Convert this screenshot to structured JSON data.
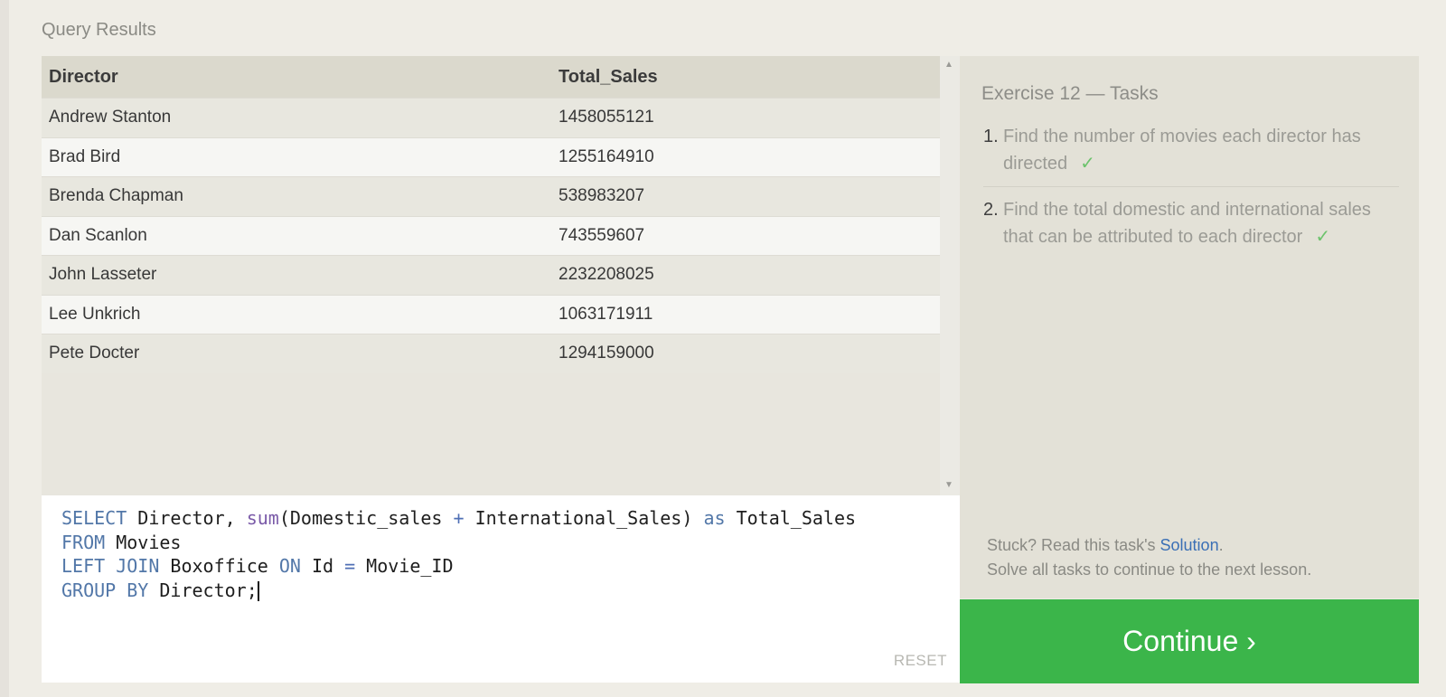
{
  "query_results": {
    "title": "Query Results",
    "columns": [
      "Director",
      "Total_Sales"
    ],
    "rows": [
      [
        "Andrew Stanton",
        "1458055121"
      ],
      [
        "Brad Bird",
        "1255164910"
      ],
      [
        "Brenda Chapman",
        "538983207"
      ],
      [
        "Dan Scanlon",
        "743559607"
      ],
      [
        "John Lasseter",
        "2232208025"
      ],
      [
        "Lee Unkrich",
        "1063171911"
      ],
      [
        "Pete Docter",
        "1294159000"
      ]
    ]
  },
  "editor": {
    "lines": [
      [
        {
          "t": "SELECT",
          "c": "kw"
        },
        {
          "t": " Director, "
        },
        {
          "t": "sum",
          "c": "fn"
        },
        {
          "t": "(Domestic_sales "
        },
        {
          "t": "+",
          "c": "op"
        },
        {
          "t": " International_Sales) "
        },
        {
          "t": "as",
          "c": "kw"
        },
        {
          "t": " Total_Sales"
        }
      ],
      [
        {
          "t": "FROM",
          "c": "kw"
        },
        {
          "t": " Movies"
        }
      ],
      [
        {
          "t": "LEFT JOIN",
          "c": "kw"
        },
        {
          "t": " Boxoffice "
        },
        {
          "t": "ON",
          "c": "kw"
        },
        {
          "t": " Id "
        },
        {
          "t": "=",
          "c": "op"
        },
        {
          "t": " Movie_ID"
        }
      ],
      [
        {
          "t": "GROUP BY",
          "c": "kw"
        },
        {
          "t": " Director;"
        }
      ]
    ],
    "reset_label": "RESET"
  },
  "tasks": {
    "title": "Exercise 12 — Tasks",
    "items": [
      {
        "num": "1.",
        "text": "Find the number of movies each director has directed",
        "done": true
      },
      {
        "num": "2.",
        "text": "Find the total domestic and international sales that can be attributed to each director",
        "done": true
      }
    ],
    "check_glyph": "✓",
    "stuck_prefix": "Stuck? Read this task's ",
    "solution_link": "Solution",
    "stuck_suffix": ".",
    "solve_all": "Solve all tasks to continue to the next lesson."
  },
  "continue_label": "Continue ›",
  "colors": {
    "continue_bg": "#3bb54a",
    "keyword": "#5277a8",
    "check": "#6cc36c",
    "link": "#3a6fb5"
  }
}
